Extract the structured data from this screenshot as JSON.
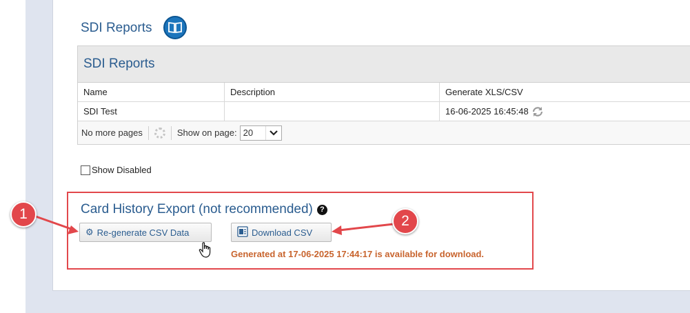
{
  "page_title": "SDI Reports",
  "grid": {
    "title": "SDI Reports",
    "columns": [
      "Name",
      "Description",
      "Generate XLS/CSV"
    ],
    "rows": [
      {
        "name": "SDI Test",
        "description": "",
        "generate": "16-06-2025 16:45:48"
      }
    ],
    "pager": {
      "no_more_pages": "No more pages",
      "show_on_page_label": "Show on page:",
      "page_size": "20"
    }
  },
  "show_disabled_label": "Show Disabled",
  "card_history": {
    "title": "Card History Export (not recommended)",
    "regen_label": "Re-generate CSV Data",
    "download_label": "Download CSV",
    "generated_text": "Generated at 17-06-2025 17:44:17 is available for download."
  },
  "markers": [
    "1",
    "2"
  ],
  "colors": {
    "accent": "#2a5c8f",
    "highlight": "#e2474b",
    "status": "#c8642e"
  },
  "icons": [
    "book-icon",
    "refresh-icon",
    "loading-spinner-icon",
    "chevron-down-icon",
    "help-icon",
    "gear-icon",
    "csv-file-icon",
    "hand-cursor-icon"
  ]
}
